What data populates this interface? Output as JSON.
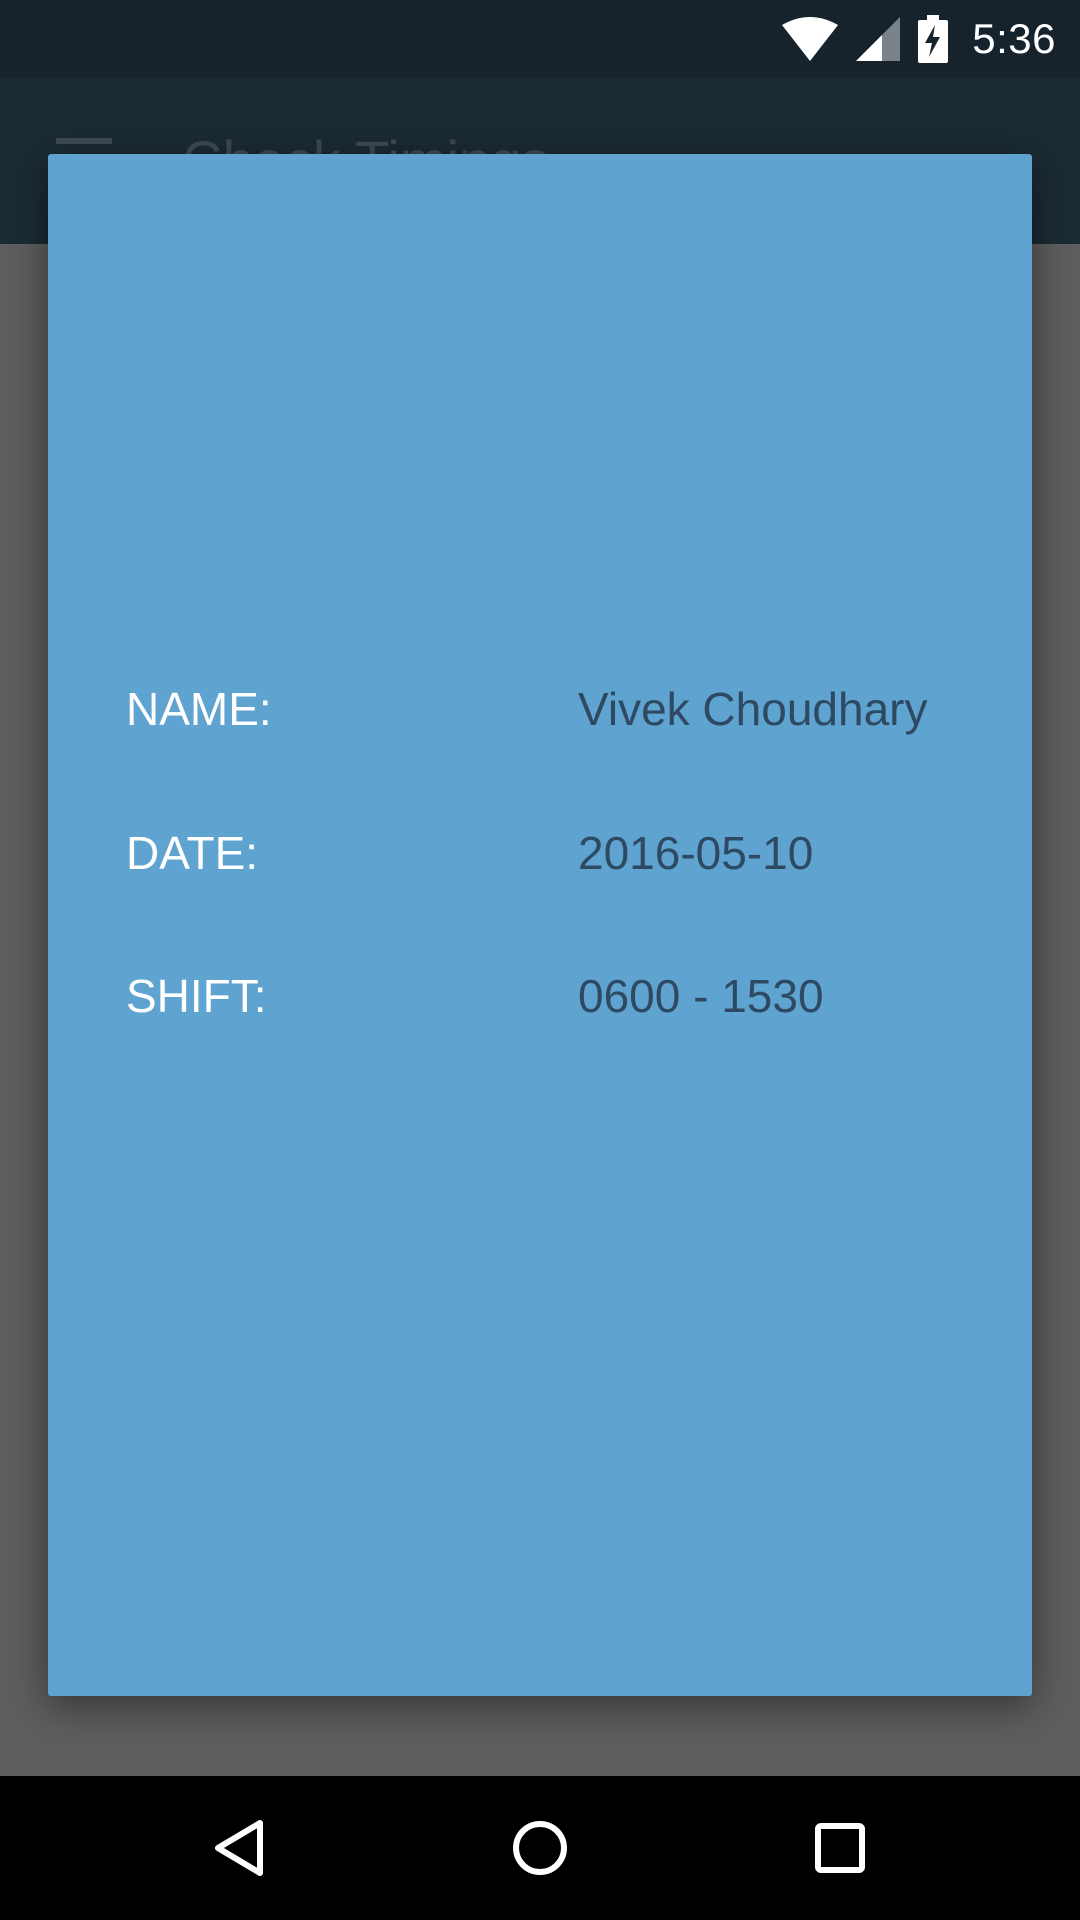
{
  "status_bar": {
    "time": "5:36",
    "icons": [
      "wifi-icon",
      "cell-signal-icon",
      "battery-charging-icon"
    ]
  },
  "app_bar": {
    "title": "Check Timings",
    "menu_icon": "hamburger-menu-icon"
  },
  "dialog": {
    "rows": [
      {
        "label": "NAME:",
        "value": "Vivek Choudhary"
      },
      {
        "label": "DATE:",
        "value": "2016-05-10"
      },
      {
        "label": "SHIFT:",
        "value": "0600 - 1530"
      }
    ]
  },
  "nav_bar": {
    "icons": [
      "back-icon",
      "home-icon",
      "recents-icon"
    ]
  },
  "colors": {
    "status_bar": "#17232c",
    "app_bar": "#1b2a33",
    "dialog_bg": "#5fa3d1",
    "label_text": "#ffffff",
    "value_text": "#2e4a62"
  }
}
